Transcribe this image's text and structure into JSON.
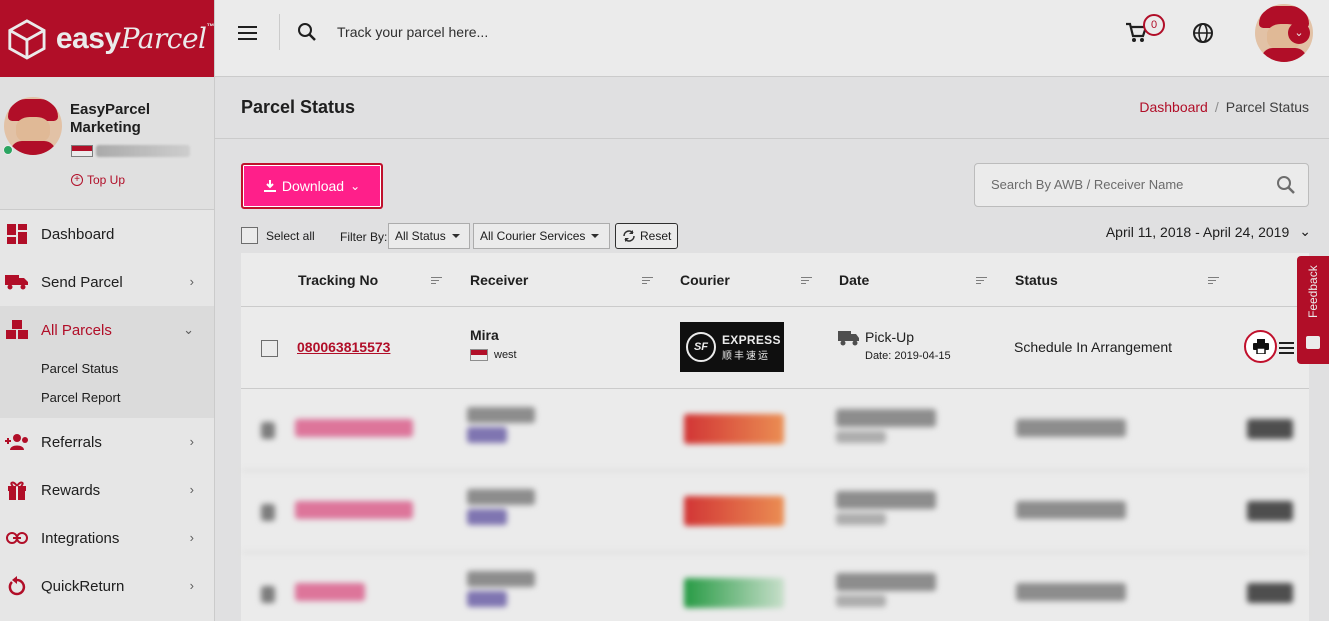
{
  "brand": {
    "name": "easy",
    "name_italic": "Parcel",
    "tm": "™"
  },
  "profile": {
    "name": "EasyParcel Marketing",
    "topup_label": "Top Up"
  },
  "nav": [
    {
      "label": "Dashboard",
      "icon": "dashboard-icon"
    },
    {
      "label": "Send Parcel",
      "icon": "truck-icon"
    },
    {
      "label": "All Parcels",
      "icon": "boxes-icon",
      "active": true
    },
    {
      "label": "Referrals",
      "icon": "users-plus-icon"
    },
    {
      "label": "Rewards",
      "icon": "gift-icon"
    },
    {
      "label": "Integrations",
      "icon": "link-icon"
    },
    {
      "label": "QuickReturn",
      "icon": "return-icon"
    }
  ],
  "subnav": [
    "Parcel Status",
    "Parcel Report"
  ],
  "topbar": {
    "search_placeholder": "Track your parcel here...",
    "cart_count": "0"
  },
  "page": {
    "title": "Parcel Status",
    "breadcrumb_link": "Dashboard",
    "breadcrumb_sep": "/",
    "breadcrumb_current": "Parcel Status"
  },
  "toolbar": {
    "download_label": "Download",
    "search_placeholder": "Search By AWB / Receiver Name",
    "select_all_label": "Select all",
    "filter_label": "Filter By:",
    "status_filter": "All Status",
    "courier_filter": "All Courier Services",
    "reset_label": "Reset",
    "date_range": "April 11, 2018 - April 24, 2019"
  },
  "table": {
    "columns": [
      "Tracking No",
      "Receiver",
      "Courier",
      "Date",
      "Status"
    ],
    "rows": [
      {
        "tracking_no": "080063815573",
        "receiver_name": "Mira",
        "receiver_area": "west",
        "courier_logo_text": "SF",
        "courier_logo_sub": "EXPRESS",
        "courier_logo_cn": "顺丰速运",
        "date_type": "Pick-Up",
        "date": "Date: 2019-04-15",
        "status": "Schedule In Arrangement"
      }
    ]
  },
  "feedback_label": "Feedback",
  "colors": {
    "brand": "#c0102c",
    "download_button": "#ff1f8a"
  }
}
